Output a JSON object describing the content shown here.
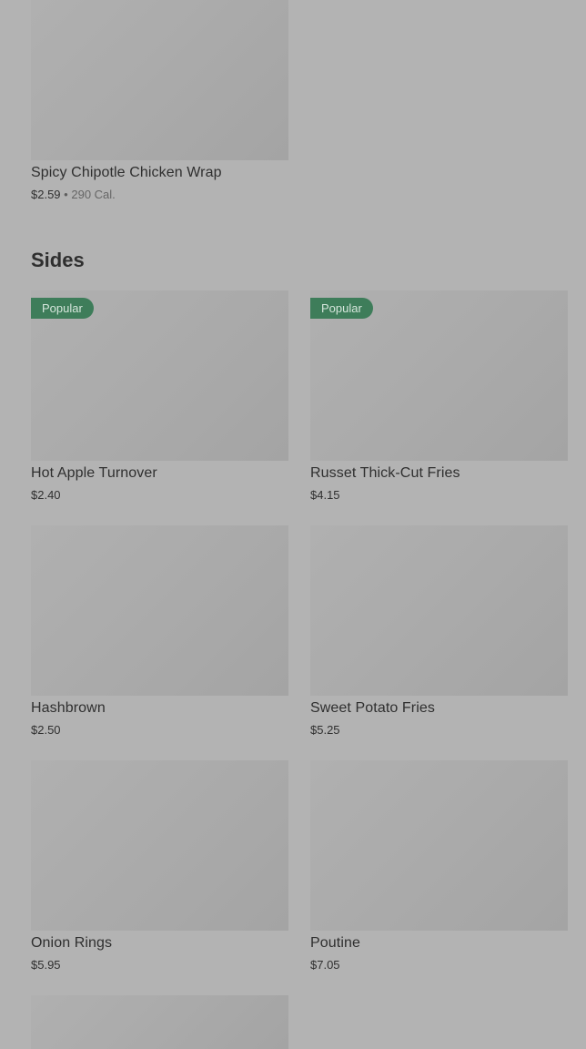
{
  "top_item": {
    "name": "Spicy Chipotle Chicken Wrap",
    "price": "$2.59",
    "separator": "•",
    "calories": "290 Cal."
  },
  "sides": {
    "title": "Sides",
    "items": [
      {
        "name": "Hot Apple Turnover",
        "price": "$2.40",
        "badge": "Popular"
      },
      {
        "name": "Russet Thick-Cut Fries",
        "price": "$4.15",
        "badge": "Popular"
      },
      {
        "name": "Hashbrown",
        "price": "$2.50"
      },
      {
        "name": "Sweet Potato Fries",
        "price": "$5.25"
      },
      {
        "name": "Onion Rings",
        "price": "$5.95"
      },
      {
        "name": "Poutine",
        "price": "$7.05"
      }
    ]
  },
  "colors": {
    "overlay_background": "#b3b3b3",
    "badge_green": "#3e7d5a",
    "text": "#2f2f2f"
  }
}
